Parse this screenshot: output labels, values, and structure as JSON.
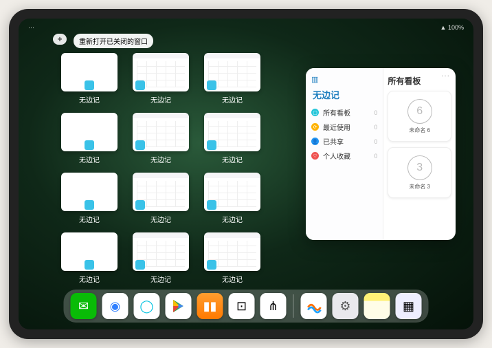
{
  "status": {
    "battery": "100%",
    "signal": "···"
  },
  "controls": {
    "add": "+",
    "reopen_label": "重新打开已关闭的窗口"
  },
  "app_label": "无边记",
  "windows": [
    {
      "variant": "blank"
    },
    {
      "variant": "grid"
    },
    {
      "variant": "grid"
    },
    {
      "variant": "blank"
    },
    {
      "variant": "grid"
    },
    {
      "variant": "grid"
    },
    {
      "variant": "blank"
    },
    {
      "variant": "grid"
    },
    {
      "variant": "grid"
    },
    {
      "variant": "blank"
    },
    {
      "variant": "grid"
    },
    {
      "variant": "grid"
    }
  ],
  "popover": {
    "left_title": "无边记",
    "right_title": "所有看板",
    "more": "···",
    "items": [
      {
        "color": "#26c6da",
        "glyph": "▢",
        "label": "所有看板",
        "count": "0"
      },
      {
        "color": "#ffb300",
        "glyph": "⟳",
        "label": "最近使用",
        "count": "0"
      },
      {
        "color": "#2196f3",
        "glyph": "👤",
        "label": "已共享",
        "count": "0"
      },
      {
        "color": "#ef5350",
        "glyph": "♡",
        "label": "个人收藏",
        "count": "0"
      }
    ],
    "boards": [
      {
        "digit": "6",
        "name": "未命名 6"
      },
      {
        "digit": "3",
        "name": "未命名 3"
      }
    ]
  },
  "dock": [
    {
      "id": "wechat",
      "name": "wechat-icon"
    },
    {
      "id": "qqblue",
      "name": "qq-browser-icon"
    },
    {
      "id": "cyan",
      "name": "browser-icon"
    },
    {
      "id": "play",
      "name": "play-store-icon"
    },
    {
      "id": "books",
      "name": "books-icon"
    },
    {
      "id": "dice",
      "name": "game-icon"
    },
    {
      "id": "graph",
      "name": "graph-icon"
    },
    {
      "sep": true
    },
    {
      "id": "freeform",
      "name": "freeform-icon"
    },
    {
      "id": "settings",
      "name": "settings-icon"
    },
    {
      "id": "notes",
      "name": "notes-icon"
    },
    {
      "id": "multi",
      "name": "app-library-icon"
    }
  ]
}
